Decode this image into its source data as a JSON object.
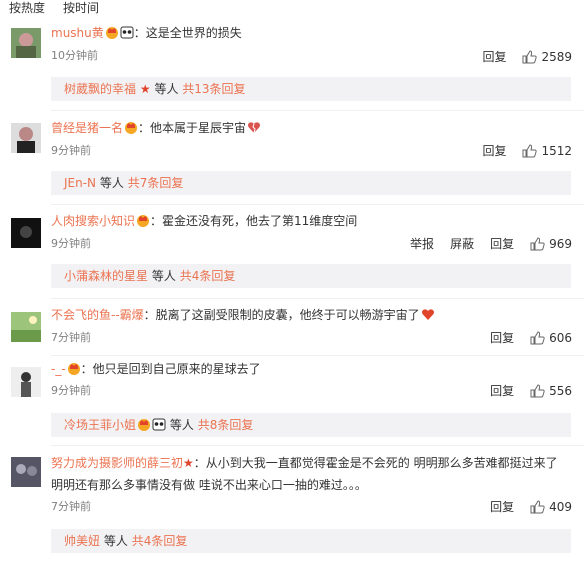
{
  "tabs": [
    "按热度",
    "按时间"
  ],
  "comments": [
    {
      "user": "mushu黄",
      "text": "：这是全世界的损失",
      "time": "10分钟前",
      "actions": [
        "回复"
      ],
      "likes": "2589",
      "reply_user": "树葳飘的幸福",
      "reply_etc": "等人",
      "reply_total": "共13条回复"
    },
    {
      "user": "曾经是猪一名",
      "text": "：他本属于星辰宇宙",
      "time": "9分钟前",
      "actions": [
        "回复"
      ],
      "likes": "1512",
      "reply_user": "JEn-N",
      "reply_etc": "等人",
      "reply_total": "共7条回复"
    },
    {
      "user": "人肉搜索小知识",
      "text": "：霍金还没有死，他去了第11维度空间",
      "time": "9分钟前",
      "actions": [
        "举报",
        "屏蔽",
        "回复"
      ],
      "likes": "969",
      "reply_user": "小蒲森林的星星",
      "reply_etc": "等人",
      "reply_total": "共4条回复"
    },
    {
      "user": "不会飞的鱼--霸爆",
      "text": "：脱离了这副受限制的皮囊，他终于可以畅游宇宙了",
      "time": "7分钟前",
      "actions": [
        "回复"
      ],
      "likes": "606"
    },
    {
      "user": "-_-",
      "text": "：他只是回到自己原来的星球去了",
      "time": "9分钟前",
      "actions": [
        "回复"
      ],
      "likes": "556",
      "reply_user": "冷场王菲小姐",
      "reply_etc": "等人",
      "reply_total": "共8条回复"
    },
    {
      "user": "努力成为摄影师的薛三初",
      "text": "：从小到大我一直都觉得霍金是不会死的  明明那么多苦难都挺过来了",
      "text2": "明明还有那么多事情没有做 哇说不出来心口一抽的难过。。。",
      "time": "7分钟前",
      "actions": [
        "回复"
      ],
      "likes": "409",
      "reply_user": "帅美妞",
      "reply_etc": "等人",
      "reply_total": "共4条回复"
    }
  ]
}
